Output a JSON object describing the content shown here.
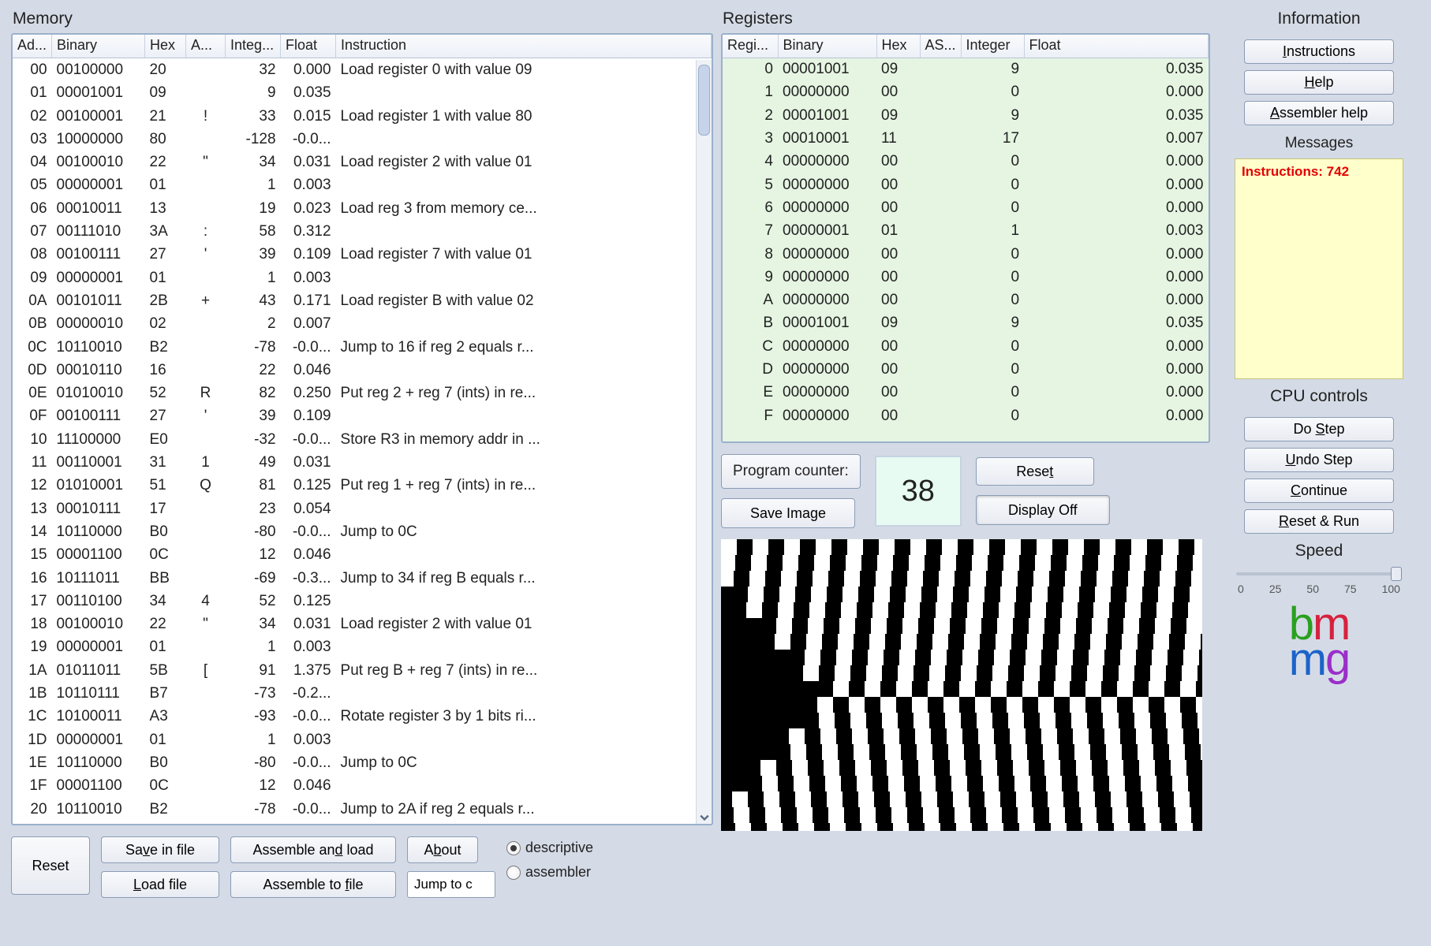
{
  "titles": {
    "memory": "Memory",
    "registers": "Registers",
    "information": "Information",
    "cpu_controls": "CPU controls",
    "messages": "Messages",
    "speed": "Speed"
  },
  "memory": {
    "headers": {
      "addr": "Ad...",
      "bin": "Binary",
      "hex": "Hex",
      "asc": "A...",
      "int": "Integ...",
      "flt": "Float",
      "inst": "Instruction"
    },
    "rows": [
      {
        "addr": "00",
        "bin": "00100000",
        "hex": "20",
        "asc": "",
        "int": "32",
        "flt": "0.000",
        "inst": "Load register 0 with value 09"
      },
      {
        "addr": "01",
        "bin": "00001001",
        "hex": "09",
        "asc": "",
        "int": "9",
        "flt": "0.035",
        "inst": ""
      },
      {
        "addr": "02",
        "bin": "00100001",
        "hex": "21",
        "asc": "!",
        "int": "33",
        "flt": "0.015",
        "inst": "Load register 1 with value 80"
      },
      {
        "addr": "03",
        "bin": "10000000",
        "hex": "80",
        "asc": "",
        "int": "-128",
        "flt": "-0.0...",
        "inst": ""
      },
      {
        "addr": "04",
        "bin": "00100010",
        "hex": "22",
        "asc": "\"",
        "int": "34",
        "flt": "0.031",
        "inst": "Load register 2 with value 01"
      },
      {
        "addr": "05",
        "bin": "00000001",
        "hex": "01",
        "asc": "",
        "int": "1",
        "flt": "0.003",
        "inst": ""
      },
      {
        "addr": "06",
        "bin": "00010011",
        "hex": "13",
        "asc": "",
        "int": "19",
        "flt": "0.023",
        "inst": "Load reg 3 from memory ce..."
      },
      {
        "addr": "07",
        "bin": "00111010",
        "hex": "3A",
        "asc": ":",
        "int": "58",
        "flt": "0.312",
        "inst": ""
      },
      {
        "addr": "08",
        "bin": "00100111",
        "hex": "27",
        "asc": "'",
        "int": "39",
        "flt": "0.109",
        "inst": "Load register 7 with value 01"
      },
      {
        "addr": "09",
        "bin": "00000001",
        "hex": "01",
        "asc": "",
        "int": "1",
        "flt": "0.003",
        "inst": ""
      },
      {
        "addr": "0A",
        "bin": "00101011",
        "hex": "2B",
        "asc": "+",
        "int": "43",
        "flt": "0.171",
        "inst": "Load register B with value 02"
      },
      {
        "addr": "0B",
        "bin": "00000010",
        "hex": "02",
        "asc": "",
        "int": "2",
        "flt": "0.007",
        "inst": ""
      },
      {
        "addr": "0C",
        "bin": "10110010",
        "hex": "B2",
        "asc": "",
        "int": "-78",
        "flt": "-0.0...",
        "inst": "Jump to 16 if reg 2 equals r..."
      },
      {
        "addr": "0D",
        "bin": "00010110",
        "hex": "16",
        "asc": "",
        "int": "22",
        "flt": "0.046",
        "inst": ""
      },
      {
        "addr": "0E",
        "bin": "01010010",
        "hex": "52",
        "asc": "R",
        "int": "82",
        "flt": "0.250",
        "inst": "Put reg 2 + reg 7 (ints) in re..."
      },
      {
        "addr": "0F",
        "bin": "00100111",
        "hex": "27",
        "asc": "'",
        "int": "39",
        "flt": "0.109",
        "inst": ""
      },
      {
        "addr": "10",
        "bin": "11100000",
        "hex": "E0",
        "asc": "",
        "int": "-32",
        "flt": "-0.0...",
        "inst": "Store R3 in memory addr in ..."
      },
      {
        "addr": "11",
        "bin": "00110001",
        "hex": "31",
        "asc": "1",
        "int": "49",
        "flt": "0.031",
        "inst": ""
      },
      {
        "addr": "12",
        "bin": "01010001",
        "hex": "51",
        "asc": "Q",
        "int": "81",
        "flt": "0.125",
        "inst": "Put reg 1 + reg 7 (ints) in re..."
      },
      {
        "addr": "13",
        "bin": "00010111",
        "hex": "17",
        "asc": "",
        "int": "23",
        "flt": "0.054",
        "inst": ""
      },
      {
        "addr": "14",
        "bin": "10110000",
        "hex": "B0",
        "asc": "",
        "int": "-80",
        "flt": "-0.0...",
        "inst": "Jump to 0C"
      },
      {
        "addr": "15",
        "bin": "00001100",
        "hex": "0C",
        "asc": "",
        "int": "12",
        "flt": "0.046",
        "inst": ""
      },
      {
        "addr": "16",
        "bin": "10111011",
        "hex": "BB",
        "asc": "",
        "int": "-69",
        "flt": "-0.3...",
        "inst": "Jump to 34 if reg B equals r..."
      },
      {
        "addr": "17",
        "bin": "00110100",
        "hex": "34",
        "asc": "4",
        "int": "52",
        "flt": "0.125",
        "inst": ""
      },
      {
        "addr": "18",
        "bin": "00100010",
        "hex": "22",
        "asc": "\"",
        "int": "34",
        "flt": "0.031",
        "inst": "Load register 2 with value 01"
      },
      {
        "addr": "19",
        "bin": "00000001",
        "hex": "01",
        "asc": "",
        "int": "1",
        "flt": "0.003",
        "inst": ""
      },
      {
        "addr": "1A",
        "bin": "01011011",
        "hex": "5B",
        "asc": "[",
        "int": "91",
        "flt": "1.375",
        "inst": "Put reg B + reg 7 (ints) in re..."
      },
      {
        "addr": "1B",
        "bin": "10110111",
        "hex": "B7",
        "asc": "",
        "int": "-73",
        "flt": "-0.2...",
        "inst": ""
      },
      {
        "addr": "1C",
        "bin": "10100011",
        "hex": "A3",
        "asc": "",
        "int": "-93",
        "flt": "-0.0...",
        "inst": "Rotate register 3 by 1 bits ri..."
      },
      {
        "addr": "1D",
        "bin": "00000001",
        "hex": "01",
        "asc": "",
        "int": "1",
        "flt": "0.003",
        "inst": ""
      },
      {
        "addr": "1E",
        "bin": "10110000",
        "hex": "B0",
        "asc": "",
        "int": "-80",
        "flt": "-0.0...",
        "inst": "Jump to 0C"
      },
      {
        "addr": "1F",
        "bin": "00001100",
        "hex": "0C",
        "asc": "",
        "int": "12",
        "flt": "0.046",
        "inst": ""
      },
      {
        "addr": "20",
        "bin": "10110010",
        "hex": "B2",
        "asc": "",
        "int": "-78",
        "flt": "-0.0...",
        "inst": "Jump to 2A if reg 2 equals r..."
      }
    ]
  },
  "registers": {
    "headers": {
      "reg": "Regi...",
      "bin": "Binary",
      "hex": "Hex",
      "asc": "AS...",
      "int": "Integer",
      "flt": "Float"
    },
    "rows": [
      {
        "reg": "0",
        "bin": "00001001",
        "hex": "09",
        "asc": "",
        "int": "9",
        "flt": "0.035"
      },
      {
        "reg": "1",
        "bin": "00000000",
        "hex": "00",
        "asc": "",
        "int": "0",
        "flt": "0.000"
      },
      {
        "reg": "2",
        "bin": "00001001",
        "hex": "09",
        "asc": "",
        "int": "9",
        "flt": "0.035"
      },
      {
        "reg": "3",
        "bin": "00010001",
        "hex": "11",
        "asc": "",
        "int": "17",
        "flt": "0.007"
      },
      {
        "reg": "4",
        "bin": "00000000",
        "hex": "00",
        "asc": "",
        "int": "0",
        "flt": "0.000"
      },
      {
        "reg": "5",
        "bin": "00000000",
        "hex": "00",
        "asc": "",
        "int": "0",
        "flt": "0.000"
      },
      {
        "reg": "6",
        "bin": "00000000",
        "hex": "00",
        "asc": "",
        "int": "0",
        "flt": "0.000"
      },
      {
        "reg": "7",
        "bin": "00000001",
        "hex": "01",
        "asc": "",
        "int": "1",
        "flt": "0.003"
      },
      {
        "reg": "8",
        "bin": "00000000",
        "hex": "00",
        "asc": "",
        "int": "0",
        "flt": "0.000"
      },
      {
        "reg": "9",
        "bin": "00000000",
        "hex": "00",
        "asc": "",
        "int": "0",
        "flt": "0.000"
      },
      {
        "reg": "A",
        "bin": "00000000",
        "hex": "00",
        "asc": "",
        "int": "0",
        "flt": "0.000"
      },
      {
        "reg": "B",
        "bin": "00001001",
        "hex": "09",
        "asc": "",
        "int": "9",
        "flt": "0.035"
      },
      {
        "reg": "C",
        "bin": "00000000",
        "hex": "00",
        "asc": "",
        "int": "0",
        "flt": "0.000"
      },
      {
        "reg": "D",
        "bin": "00000000",
        "hex": "00",
        "asc": "",
        "int": "0",
        "flt": "0.000"
      },
      {
        "reg": "E",
        "bin": "00000000",
        "hex": "00",
        "asc": "",
        "int": "0",
        "flt": "0.000"
      },
      {
        "reg": "F",
        "bin": "00000000",
        "hex": "00",
        "asc": "",
        "int": "0",
        "flt": "0.000"
      }
    ]
  },
  "pc": {
    "label": "Program counter:",
    "value": "38"
  },
  "buttons": {
    "reset_mem": "Reset",
    "save_file": "Save in file",
    "load_file": "Load file",
    "assemble_load": "Assemble and load",
    "assemble_file": "Assemble to file",
    "about": "About",
    "jump_placeholder": "Jump to c",
    "reset_pc": "Reset",
    "save_image": "Save Image",
    "display_off": "Display Off",
    "instructions": "Instructions",
    "help": "Help",
    "asm_help": "Assembler help",
    "do_step": "Do Step",
    "undo_step": "Undo Step",
    "continue": "Continue",
    "reset_run": "Reset & Run"
  },
  "radio": {
    "descriptive": "descriptive",
    "assembler": "assembler",
    "selected": "descriptive"
  },
  "messages": {
    "text": "Instructions: 742"
  },
  "speed": {
    "ticks": [
      "0",
      "25",
      "50",
      "75",
      "100"
    ],
    "value": 100
  },
  "logo": {
    "l1a": "b",
    "l1b": "m",
    "l2a": "m",
    "l2b": "g"
  }
}
